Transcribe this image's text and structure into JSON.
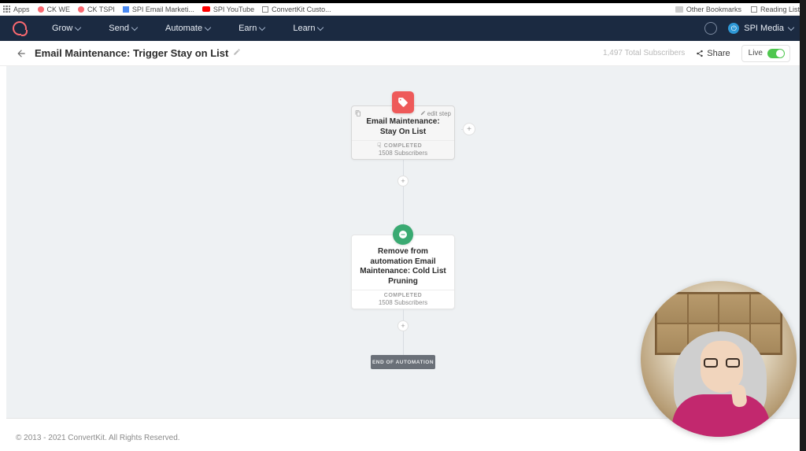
{
  "bookmarks": {
    "apps": "Apps",
    "items": [
      "CK WE",
      "CK TSPI",
      "SPI Email Marketi...",
      "SPI YouTube",
      "ConvertKit Custo..."
    ],
    "other": "Other Bookmarks",
    "reading": "Reading List"
  },
  "nav": {
    "items": [
      "Grow",
      "Send",
      "Automate",
      "Earn",
      "Learn"
    ],
    "account": "SPI Media"
  },
  "header": {
    "title": "Email Maintenance: Trigger Stay on List",
    "subscribers": "1,497 Total Subscribers",
    "share": "Share",
    "live": "Live"
  },
  "flow": {
    "trigger": {
      "edit_step": "edit step",
      "title": "Email Maintenance: Stay On List",
      "status": "COMPLETED",
      "subs": "1508 Subscribers"
    },
    "action": {
      "title": "Remove from automation Email Maintenance: Cold List Pruning",
      "status": "COMPLETED",
      "subs": "1508 Subscribers"
    },
    "end": "END OF AUTOMATION"
  },
  "footer": "© 2013 - 2021 ConvertKit. All Rights Reserved."
}
